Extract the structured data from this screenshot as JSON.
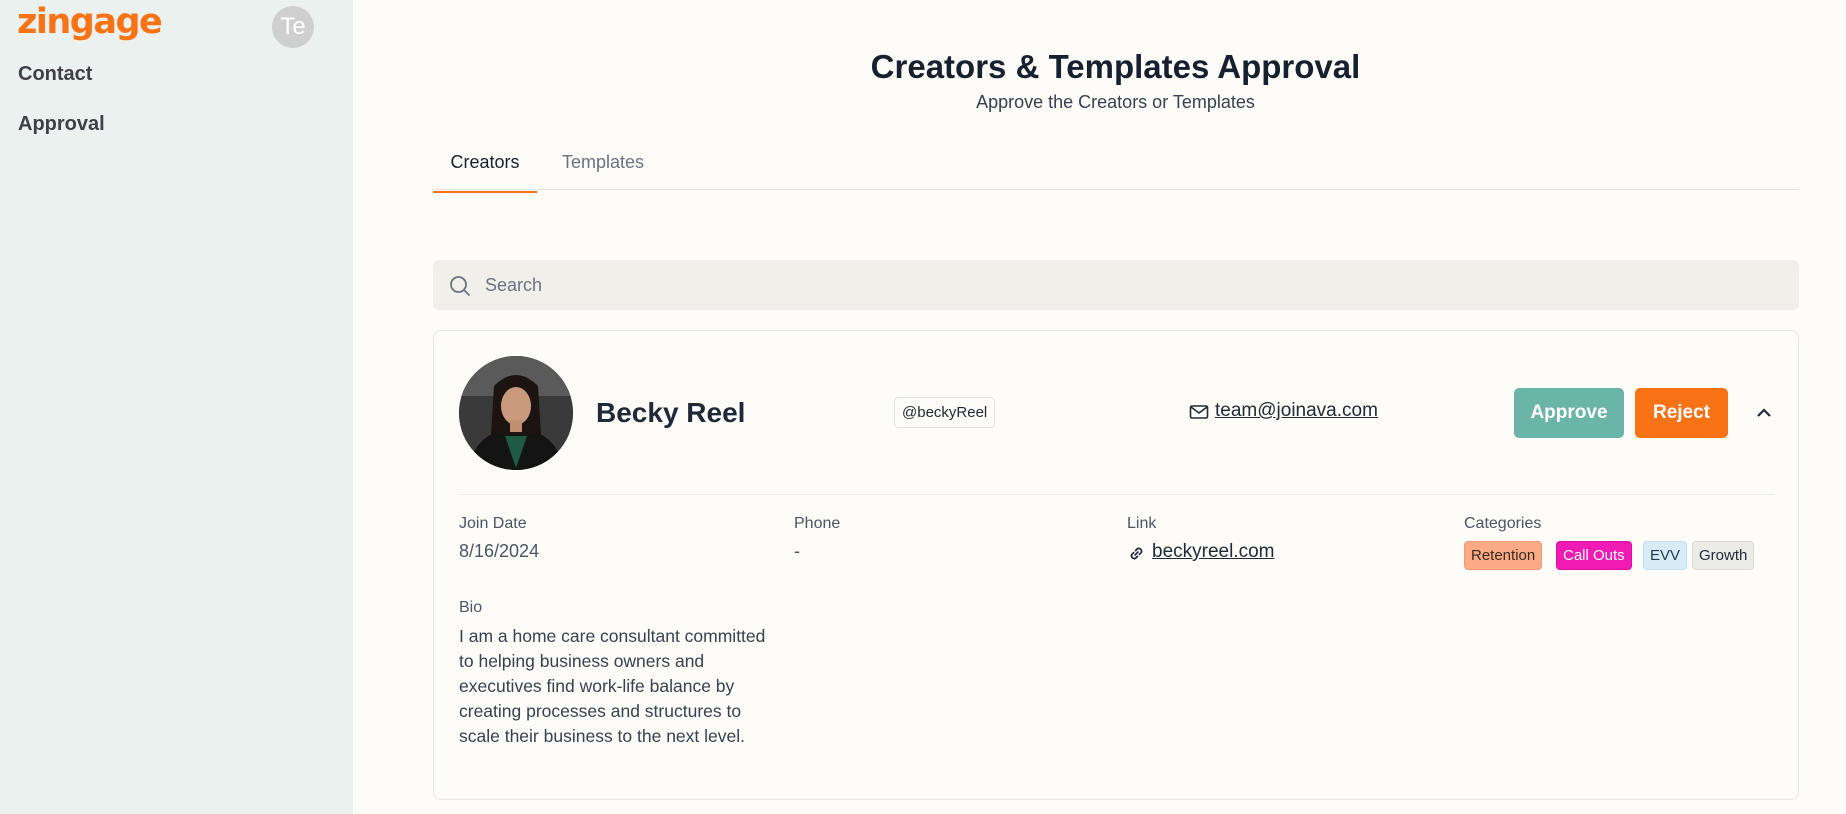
{
  "sidebar": {
    "logo": "zingage",
    "avatar_initials": "Te",
    "nav": [
      {
        "label": "Contact"
      },
      {
        "label": "Approval"
      }
    ]
  },
  "header": {
    "title": "Creators & Templates Approval",
    "subtitle": "Approve the Creators or Templates"
  },
  "tabs": [
    {
      "label": "Creators",
      "active": true
    },
    {
      "label": "Templates",
      "active": false
    }
  ],
  "search": {
    "placeholder": "Search",
    "value": ""
  },
  "creator": {
    "name": "Becky Reel",
    "handle": "@beckyReel",
    "email": "team@joinava.com",
    "approve_label": "Approve",
    "reject_label": "Reject",
    "fields": {
      "join_date_label": "Join Date",
      "join_date": "8/16/2024",
      "phone_label": "Phone",
      "phone": "-",
      "link_label": "Link",
      "link": "beckyreel.com",
      "categories_label": "Categories",
      "categories": [
        "Retention",
        "Call Outs",
        "EVV",
        "Growth"
      ],
      "bio_label": "Bio",
      "bio": "I am a home care consultant committed to helping business owners and executives find work-life balance by creating processes and structures to scale their business to the next level."
    }
  },
  "colors": {
    "brand": "#f97316",
    "approve": "#6bb5a8",
    "reject": "#f97316",
    "sidebar_bg": "#eaf1ef",
    "page_bg": "#fdfcf8"
  },
  "icons": [
    "search-icon",
    "mail-icon",
    "link-icon",
    "chevron-up-icon"
  ]
}
